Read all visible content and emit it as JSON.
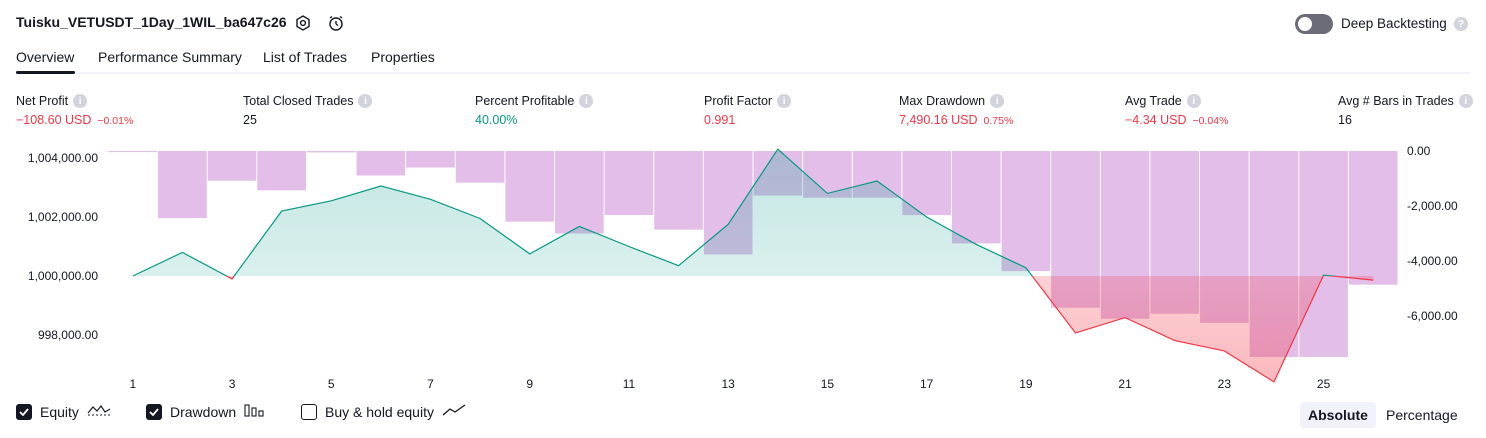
{
  "header": {
    "title": "Tuisku_VETUSDT_1Day_1WIL_ba647c26",
    "deep_backtesting_label": "Deep Backtesting",
    "deep_backtesting_on": false
  },
  "tabs": [
    {
      "label": "Overview",
      "active": true
    },
    {
      "label": "Performance Summary",
      "active": false
    },
    {
      "label": "List of Trades",
      "active": false
    },
    {
      "label": "Properties",
      "active": false
    }
  ],
  "metrics": [
    {
      "label": "Net Profit",
      "value": "−108.60 USD",
      "sub": "−0.01%",
      "color": "#f23645"
    },
    {
      "label": "Total Closed Trades",
      "value": "25",
      "sub": "",
      "color": "#131722"
    },
    {
      "label": "Percent Profitable",
      "value": "40.00%",
      "sub": "",
      "color": "#089981"
    },
    {
      "label": "Profit Factor",
      "value": "0.991",
      "sub": "",
      "color": "#f23645"
    },
    {
      "label": "Max Drawdown",
      "value": "7,490.16 USD",
      "sub": "0.75%",
      "color": "#f23645"
    },
    {
      "label": "Avg Trade",
      "value": "−4.34 USD",
      "sub": "−0.04%",
      "color": "#f23645"
    },
    {
      "label": "Avg # Bars in Trades",
      "value": "16",
      "sub": "",
      "color": "#131722"
    }
  ],
  "chart_data": {
    "type": "line",
    "x": [
      1,
      2,
      3,
      4,
      5,
      6,
      7,
      8,
      9,
      10,
      11,
      12,
      13,
      14,
      15,
      16,
      17,
      18,
      19,
      20,
      21,
      22,
      23,
      24,
      25,
      26
    ],
    "x_ticks": [
      "1",
      "3",
      "5",
      "7",
      "9",
      "11",
      "13",
      "15",
      "17",
      "19",
      "21",
      "23",
      "25"
    ],
    "series": [
      {
        "name": "Equity",
        "axis": "left",
        "values": [
          1000000,
          1000800,
          999900,
          1002200,
          1002550,
          1003050,
          1002600,
          1001950,
          1000750,
          1001680,
          1001000,
          1000350,
          1001750,
          1004300,
          1002800,
          1003220,
          1002000,
          1001070,
          1000280,
          998070,
          998590,
          997810,
          997460,
          996410,
          1000030,
          999860
        ],
        "color_up": "#089981",
        "color_down": "#f23645"
      },
      {
        "name": "Drawdown",
        "axis": "right",
        "values": [
          -40,
          -2440,
          -1080,
          -1430,
          -50,
          -890,
          -600,
          -1150,
          -2570,
          -3000,
          -2330,
          -2860,
          -3760,
          -1620,
          -1700,
          -1700,
          -2330,
          -3360,
          -4370,
          -5700,
          -6100,
          -5920,
          -6250,
          -7490,
          -7490,
          -4860
        ],
        "color": "#ce93d8"
      }
    ],
    "left_ticks": [
      "1,004,000.00",
      "1,002,000.00",
      "1,000,000.00",
      "998,000.00"
    ],
    "right_ticks": [
      "0.00",
      "-2,000.00",
      "-4,000.00",
      "-6,000.00"
    ],
    "ylim_left": [
      996000,
      1004300
    ],
    "ylim_right": [
      -8800,
      0
    ],
    "baseline": 1000000
  },
  "legend": [
    {
      "label": "Equity",
      "checked": true,
      "icon": "equity-icon"
    },
    {
      "label": "Drawdown",
      "checked": true,
      "icon": "drawdown-bars-icon"
    },
    {
      "label": "Buy & hold equity",
      "checked": false,
      "icon": "buy-hold-line-icon"
    }
  ],
  "mode": {
    "absolute_label": "Absolute",
    "percentage_label": "Percentage",
    "selected": "Absolute"
  }
}
